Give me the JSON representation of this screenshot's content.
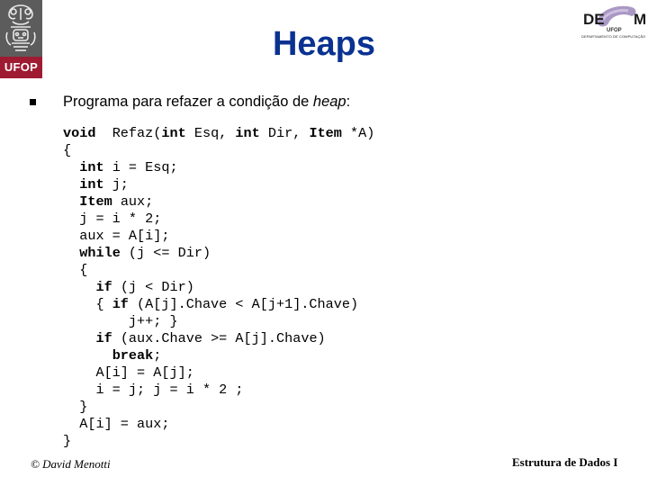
{
  "header": {
    "left_logo_text": "UFOP",
    "right_logo_text_left": "DE",
    "right_logo_text_right": "M",
    "right_logo_sub": "UFOP",
    "right_logo_dept": "DEPARTAMENTO DE COMPUTAÇÃO",
    "accent_color": "#0a3291",
    "ufop_color": "#9e1b32"
  },
  "slide": {
    "title": "Heaps",
    "bullet_text_prefix": "Programa para refazer a condição de ",
    "bullet_text_italic": "heap",
    "bullet_text_suffix": ":",
    "code_lines": [
      [
        {
          "t": "void",
          "b": true
        },
        {
          "t": "  Refaz("
        },
        {
          "t": "int",
          "b": true
        },
        {
          "t": " Esq, "
        },
        {
          "t": "int",
          "b": true
        },
        {
          "t": " Dir, "
        },
        {
          "t": "Item",
          "b": true
        },
        {
          "t": " *A)"
        }
      ],
      [
        {
          "t": "{"
        }
      ],
      [
        {
          "t": "  "
        },
        {
          "t": "int",
          "b": true
        },
        {
          "t": " i = Esq;"
        }
      ],
      [
        {
          "t": "  "
        },
        {
          "t": "int",
          "b": true
        },
        {
          "t": " j;"
        }
      ],
      [
        {
          "t": "  "
        },
        {
          "t": "Item",
          "b": true
        },
        {
          "t": " aux;"
        }
      ],
      [
        {
          "t": "  j = i * 2;"
        }
      ],
      [
        {
          "t": "  aux = A[i];"
        }
      ],
      [
        {
          "t": "  "
        },
        {
          "t": "while",
          "b": true
        },
        {
          "t": " (j <= Dir)"
        }
      ],
      [
        {
          "t": "  {"
        }
      ],
      [
        {
          "t": "    "
        },
        {
          "t": "if",
          "b": true
        },
        {
          "t": " (j < Dir)"
        }
      ],
      [
        {
          "t": "    { "
        },
        {
          "t": "if",
          "b": true
        },
        {
          "t": " (A[j].Chave < A[j+1].Chave)"
        }
      ],
      [
        {
          "t": "        j++; }"
        }
      ],
      [
        {
          "t": "    "
        },
        {
          "t": "if",
          "b": true
        },
        {
          "t": " (aux.Chave >= A[j].Chave)"
        }
      ],
      [
        {
          "t": "      "
        },
        {
          "t": "break",
          "b": true
        },
        {
          "t": ";"
        }
      ],
      [
        {
          "t": "    A[i] = A[j];"
        }
      ],
      [
        {
          "t": "    i = j; j = i * 2 ;"
        }
      ],
      [
        {
          "t": "  }"
        }
      ],
      [
        {
          "t": "  A[i] = aux;"
        }
      ],
      [
        {
          "t": "}"
        }
      ]
    ]
  },
  "footer": {
    "author": "© David Menotti",
    "course": "Estrutura de Dados I"
  }
}
